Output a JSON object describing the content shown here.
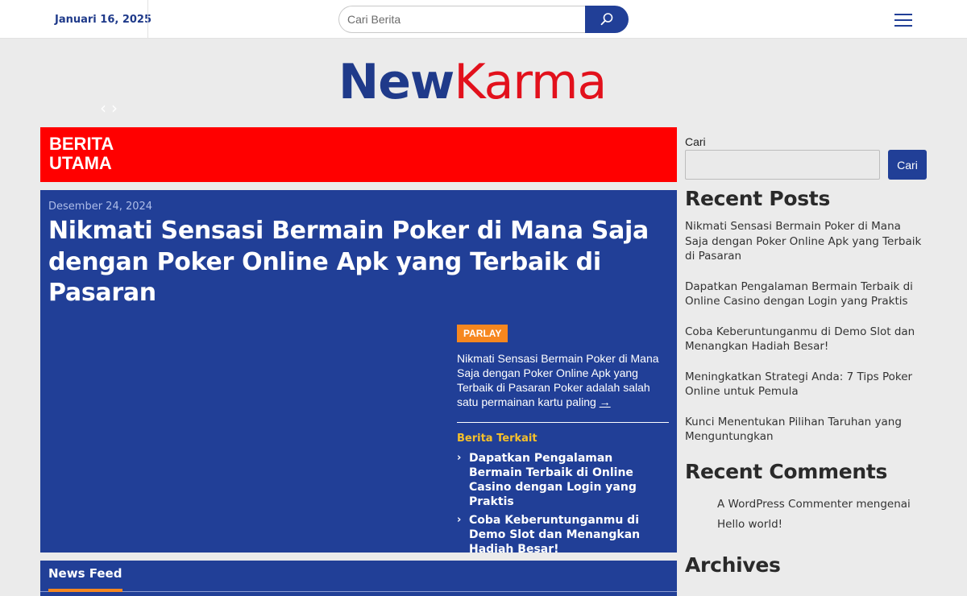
{
  "topbar": {
    "date": "Januari 16, 2025",
    "search_placeholder": "Cari Berita"
  },
  "logo": {
    "part1": "New",
    "part2": "Karma"
  },
  "banner": {
    "title": "BERITA UTAMA"
  },
  "featured": {
    "date": "Desember 24, 2024",
    "title": "Nikmati Sensasi Bermain Poker di Mana Saja dengan Poker Online Apk yang Terbaik di Pasaran",
    "tag": "PARLAY",
    "excerpt": "Nikmati Sensasi Bermain Poker di Mana Saja dengan Poker Online Apk yang Terbaik di Pasaran Poker adalah salah satu permainan kartu paling",
    "more_glyph": "→",
    "related_title": "Berita Terkait",
    "related": [
      "Dapatkan Pengalaman Bermain Terbaik di Online Casino dengan Login yang Praktis",
      "Coba Keberuntunganmu di Demo Slot dan Menangkan Hadiah Besar!"
    ]
  },
  "newsfeed": {
    "title": "News Feed"
  },
  "sidebar": {
    "search_label": "Cari",
    "search_button": "Cari",
    "recent_posts_title": "Recent Posts",
    "recent_posts": [
      "Nikmati Sensasi Bermain Poker di Mana Saja dengan Poker Online Apk yang Terbaik di Pasaran",
      "Dapatkan Pengalaman Bermain Terbaik di Online Casino dengan Login yang Praktis",
      "Coba Keberuntunganmu di Demo Slot dan Menangkan Hadiah Besar!",
      "Meningkatkan Strategi Anda: 7 Tips Poker Online untuk Pemula",
      "Kunci Menentukan Pilihan Taruhan yang Menguntungkan"
    ],
    "recent_comments_title": "Recent Comments",
    "comment_author": "A WordPress Commenter",
    "comment_connector": "mengenai",
    "comment_post": "Hello world!",
    "archives_title": "Archives"
  },
  "colors": {
    "brand_blue": "#213f97",
    "brand_red": "#e2111c",
    "banner_red": "#ff0000",
    "accent_orange": "#f6871f",
    "accent_yellow": "#f6c02a"
  },
  "icons": {
    "search": "search-icon",
    "menu": "hamburger-menu-icon",
    "prev": "chevron-left-icon",
    "next": "chevron-right-icon",
    "related_bullet": "chevron-right-icon"
  }
}
